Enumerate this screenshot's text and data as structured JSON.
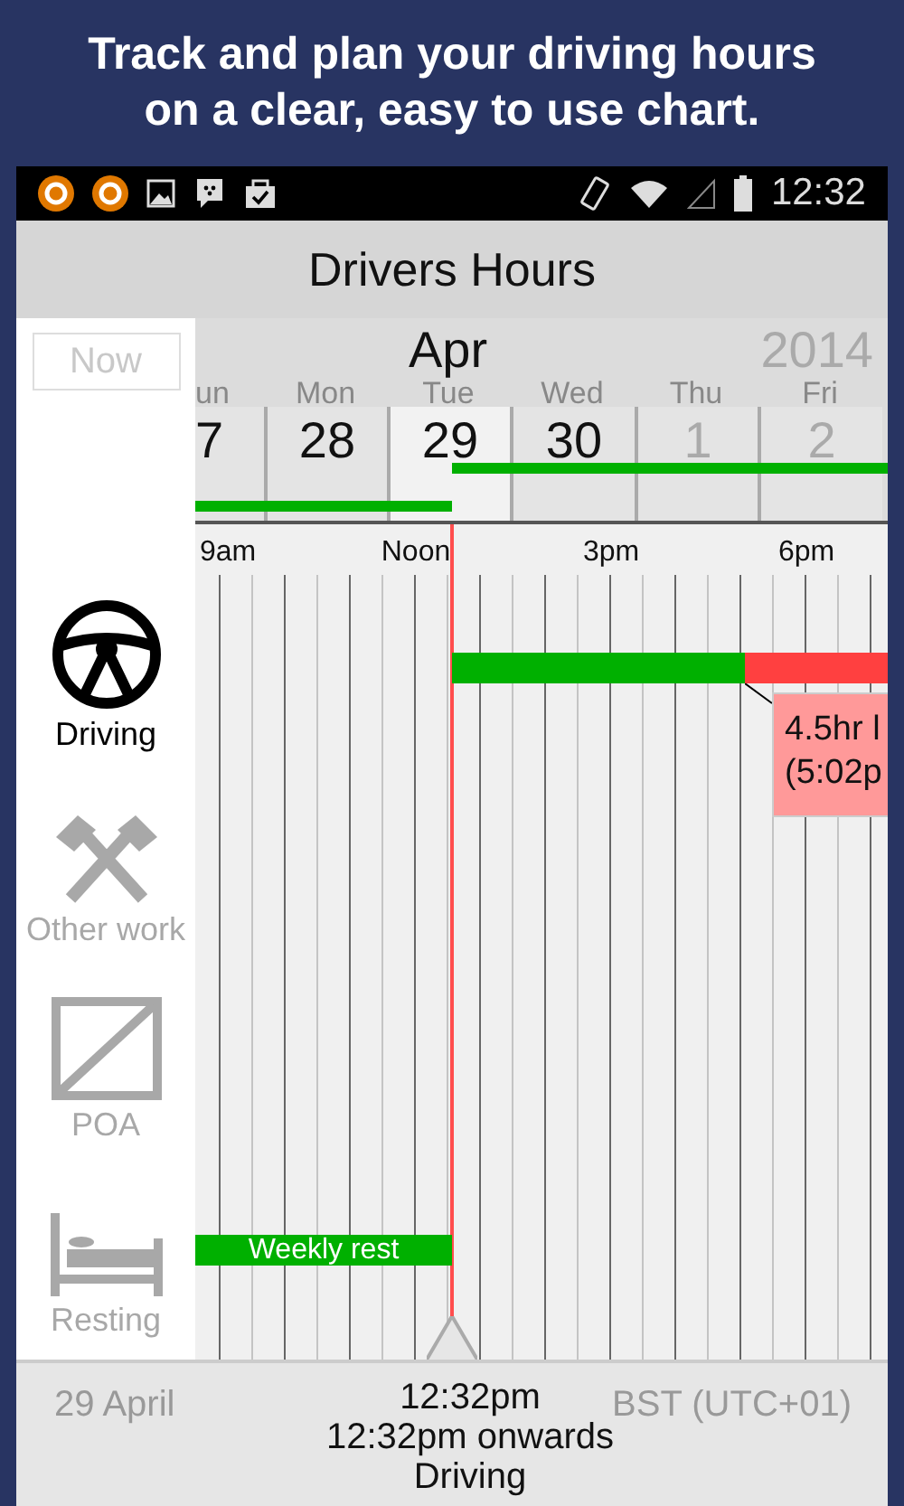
{
  "headline": [
    "Track and plan your driving hours",
    "on a clear, easy to use chart."
  ],
  "status_bar": {
    "time": "12:32"
  },
  "app_bar": {
    "title": "Drivers Hours"
  },
  "now_button": {
    "label": "Now"
  },
  "calendar": {
    "month": "Apr",
    "year": "2014",
    "days": [
      {
        "weekday": "un",
        "date": "7",
        "selected": false,
        "muted": false
      },
      {
        "weekday": "Mon",
        "date": "28",
        "selected": false,
        "muted": false
      },
      {
        "weekday": "Tue",
        "date": "29",
        "selected": true,
        "muted": false
      },
      {
        "weekday": "Wed",
        "date": "30",
        "selected": false,
        "muted": false
      },
      {
        "weekday": "Thu",
        "date": "1",
        "selected": false,
        "muted": true
      },
      {
        "weekday": "Fri",
        "date": "2",
        "selected": false,
        "muted": true
      }
    ]
  },
  "time_axis": [
    "9am",
    "Noon",
    "3pm",
    "6pm"
  ],
  "activities": [
    {
      "kind": "driving",
      "label": "Driving",
      "selected": true
    },
    {
      "kind": "other_work",
      "label": "Other work",
      "selected": false
    },
    {
      "kind": "poa",
      "label": "POA",
      "selected": false
    },
    {
      "kind": "resting",
      "label": "Resting",
      "selected": false
    }
  ],
  "bars": [
    {
      "kind": "ok"
    },
    {
      "kind": "limit"
    },
    {
      "kind": "ok",
      "label": "Weekly rest"
    }
  ],
  "tooltip": {
    "lines": [
      "4.5hr l",
      "(5:02p"
    ]
  },
  "footer": {
    "date": "29 April",
    "time": "12:32pm",
    "period": "12:32pm onwards",
    "activity": "Driving",
    "timezone": "BST (UTC+01)"
  }
}
